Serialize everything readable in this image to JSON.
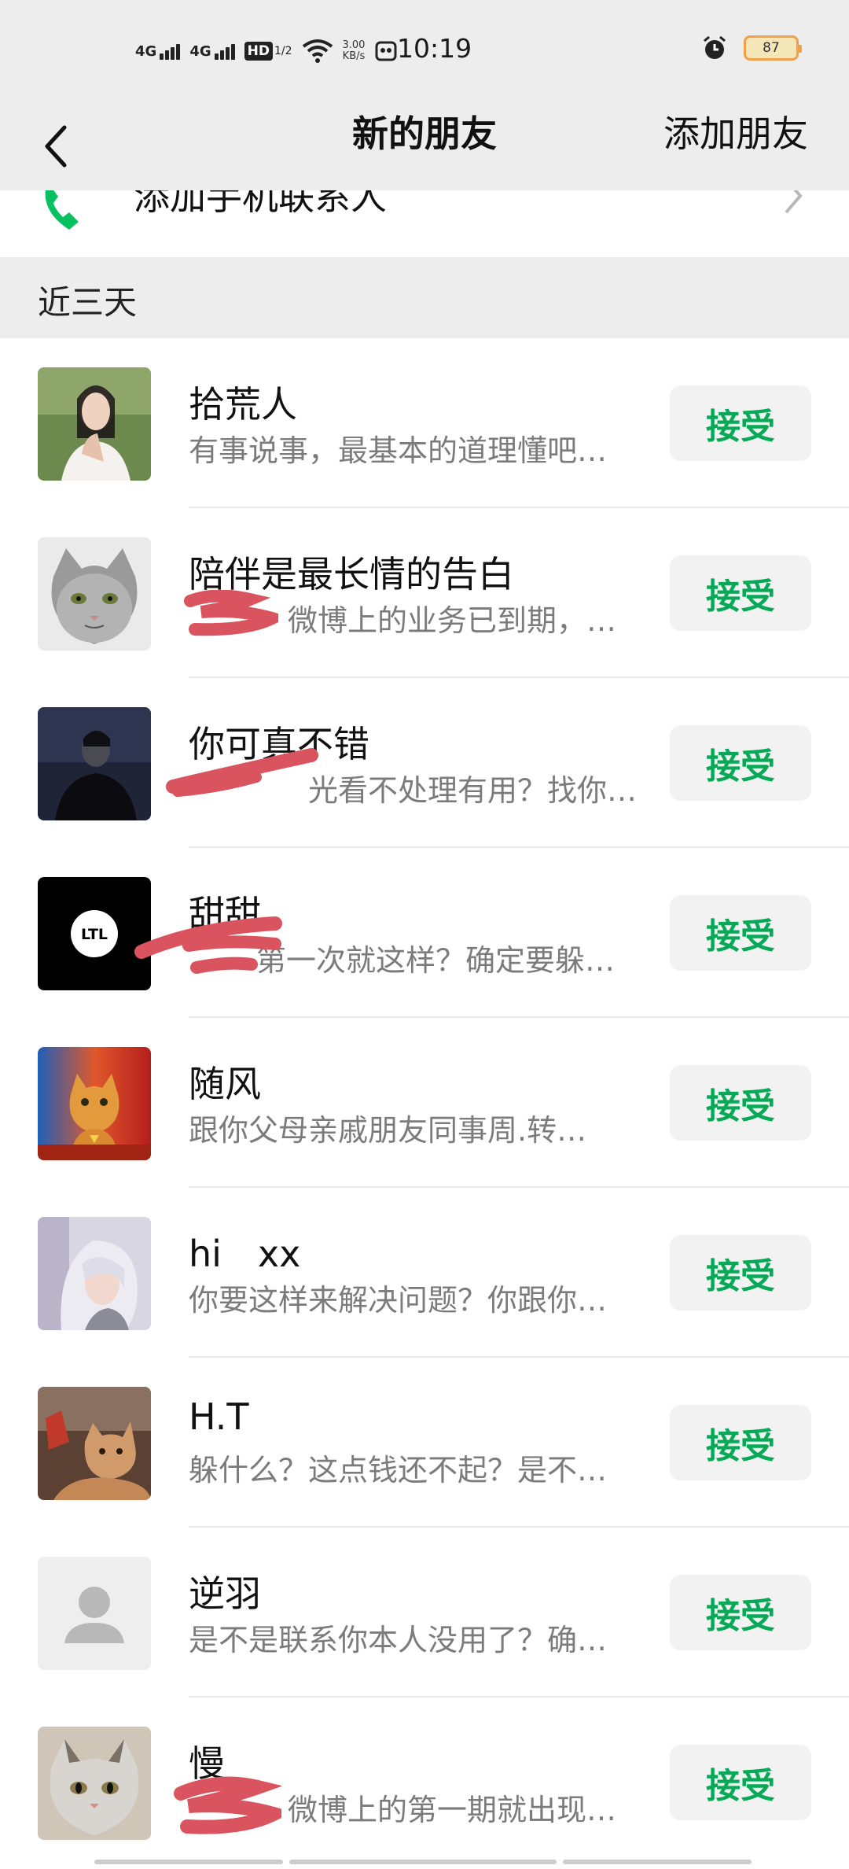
{
  "status_bar": {
    "time": "10:19",
    "network1": "4G",
    "network2": "4G",
    "hd_label": "HD",
    "hd_sub": "1/2",
    "speed_value": "3.00",
    "speed_unit": "KB/s",
    "battery": "87"
  },
  "nav": {
    "title": "新的朋友",
    "action": "添加朋友"
  },
  "top_row": {
    "label": "添加手机联系人"
  },
  "section": {
    "title": "近三天"
  },
  "accept_label": "接受",
  "requests": [
    {
      "name": "拾荒人",
      "message": "有事说事，最基本的道理懂吧…",
      "avatar": "portrait-woman"
    },
    {
      "name": "陪伴是最长情的告白",
      "message": "微博上的业务已到期，…",
      "avatar": "gray-cat"
    },
    {
      "name": "你可真不错",
      "message": "光看不处理有用？找你…",
      "avatar": "dark-portrait"
    },
    {
      "name": "甜甜",
      "message": "第一次就这样？确定要躲…",
      "avatar": "ltl-logo"
    },
    {
      "name": "随风",
      "message": "跟你父母亲戚朋友同事周.转…",
      "avatar": "orange-cat-poster"
    },
    {
      "name": "hi　xx",
      "message": "你要这样来解决问题？你跟你…",
      "avatar": "silver-hair-girl"
    },
    {
      "name": "H.T",
      "message": "躲什么？这点钱还不起？是不…",
      "avatar": "cat-photo"
    },
    {
      "name": "逆羽",
      "message": "是不是联系你本人没用了？确…",
      "avatar": "default-avatar"
    },
    {
      "name": "慢",
      "message": "微博上的第一期就出现…",
      "avatar": "white-cat"
    }
  ],
  "colors": {
    "accent": "#07a856",
    "header_bg": "#ededed",
    "redaction": "#d9545e"
  }
}
